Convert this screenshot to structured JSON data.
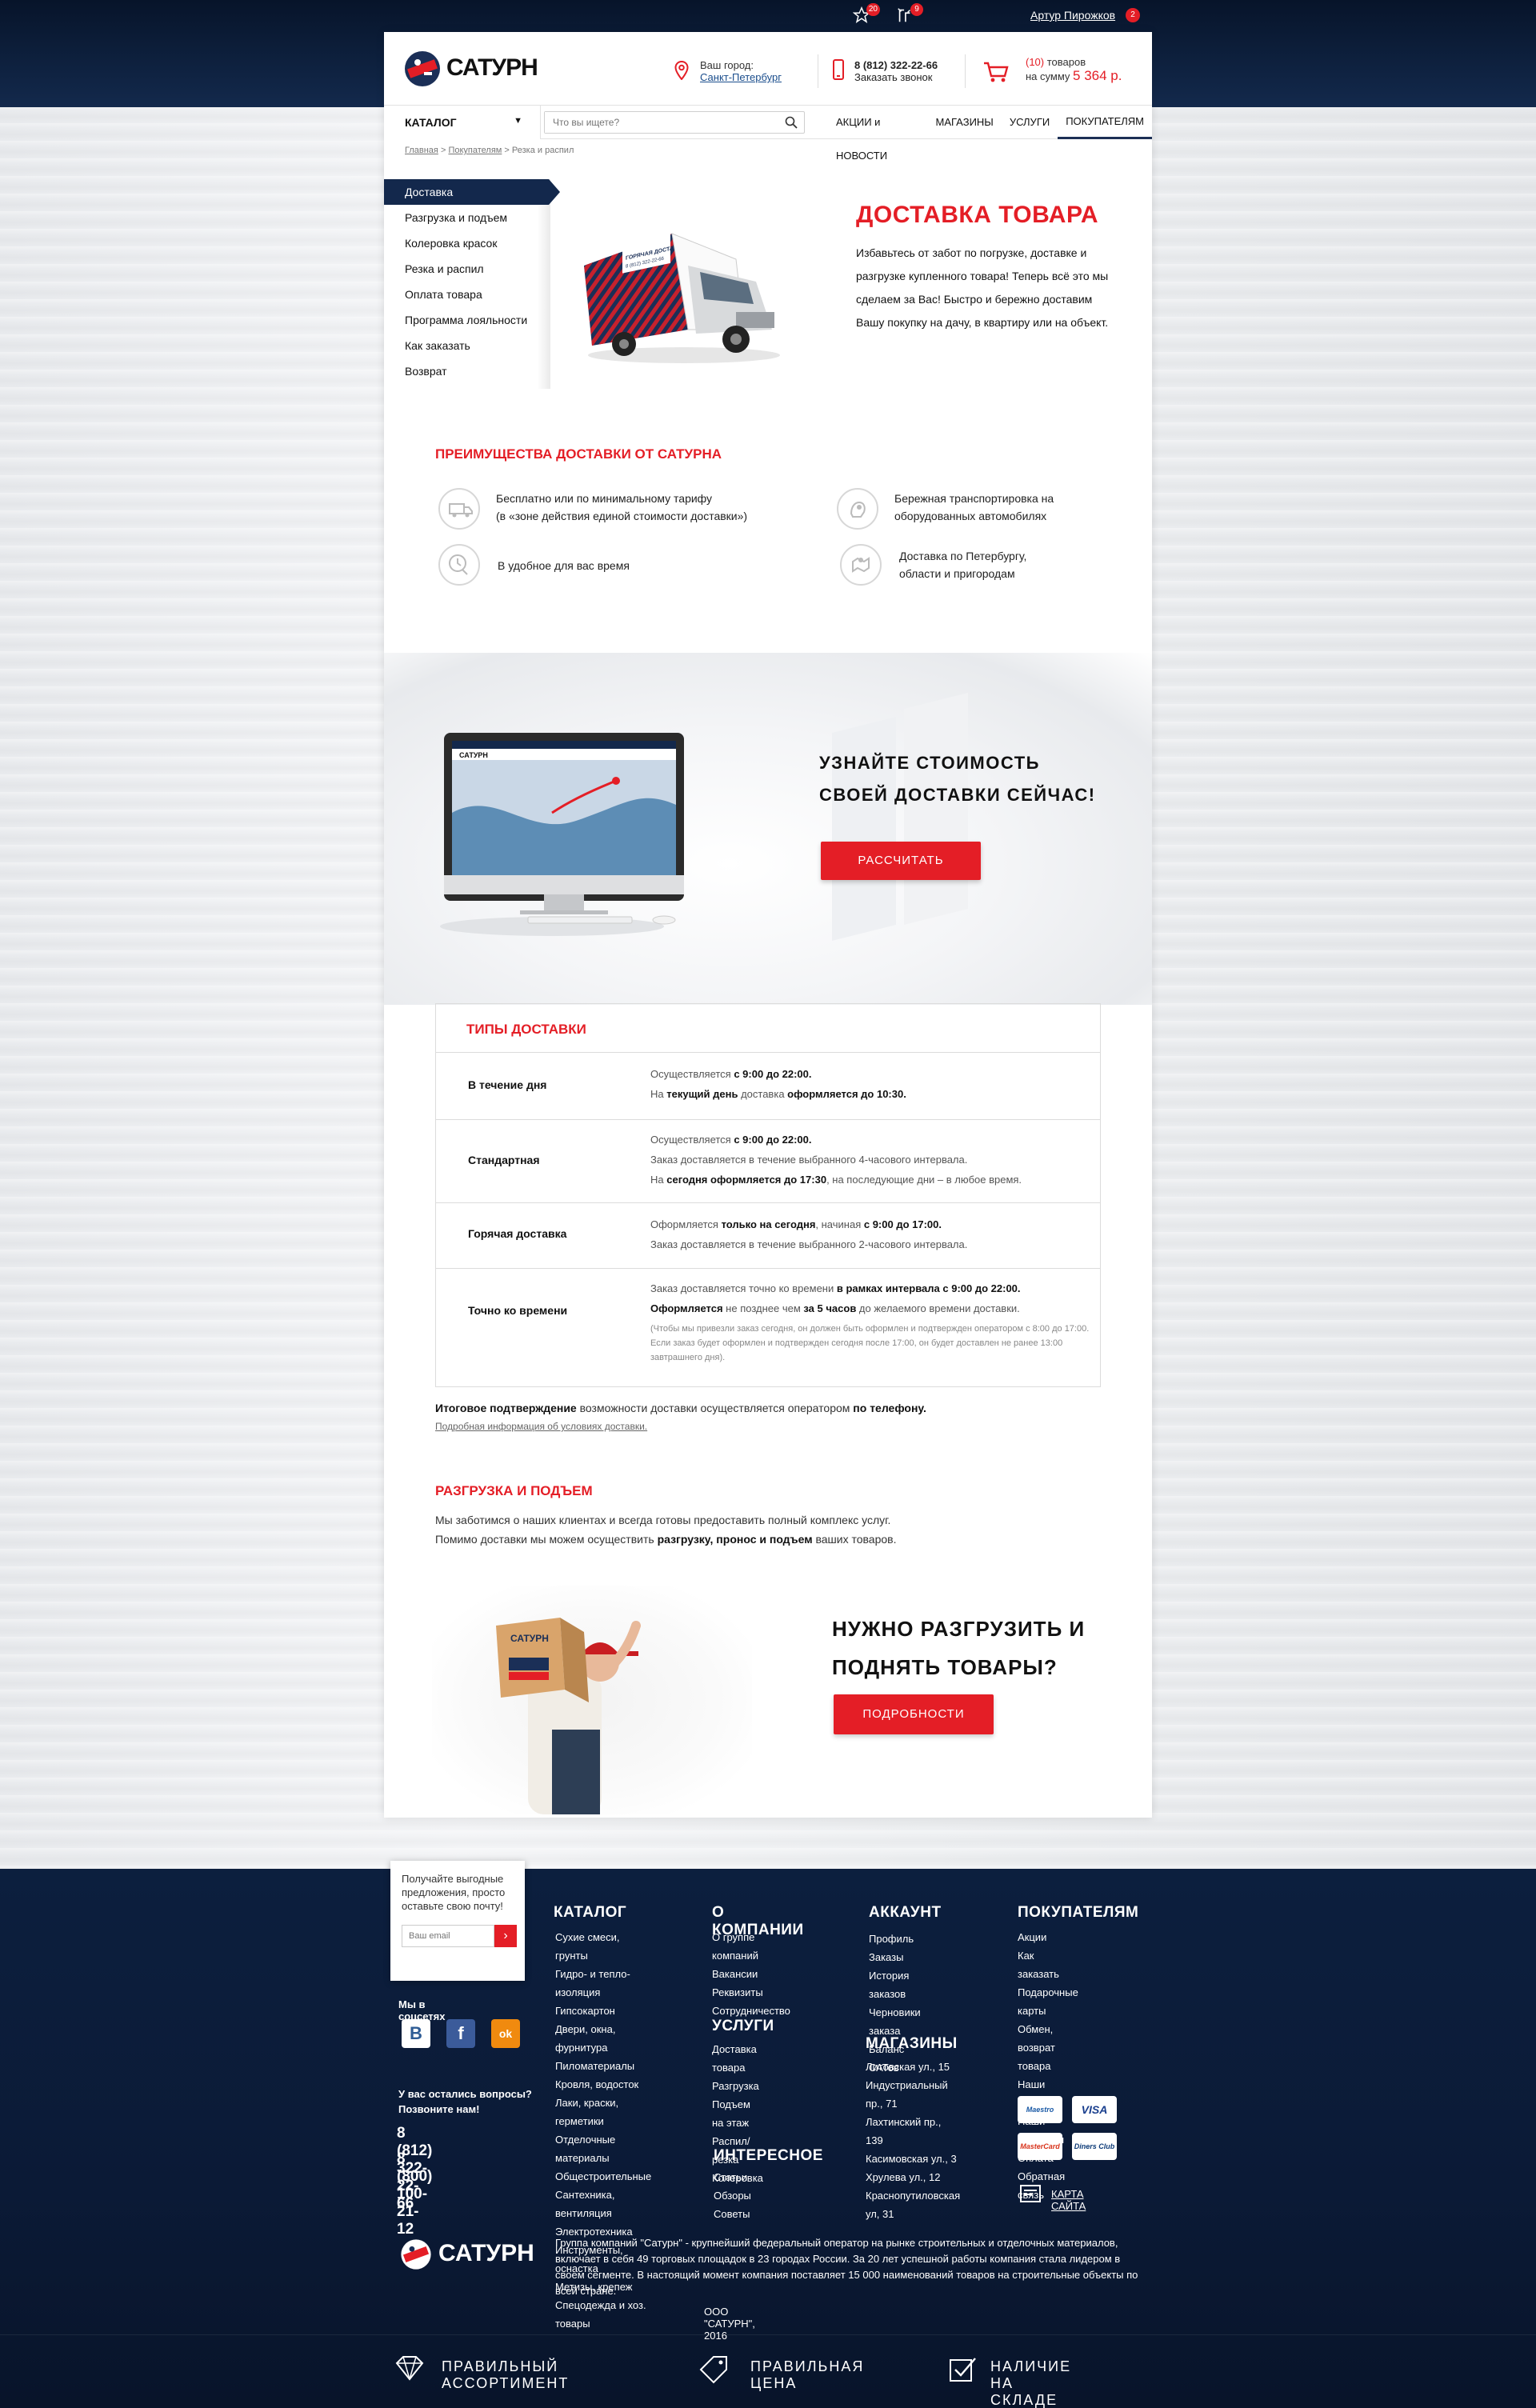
{
  "topbar": {
    "favorites_count": "20",
    "compare_count": "9",
    "user_name": "Артур Пирожков",
    "user_badge": "2"
  },
  "header": {
    "logo_text": "САТУРН",
    "city_label": "Ваш город:",
    "city_value": "Санкт-Петербург",
    "phone": "8 (812) 322-22-66",
    "callback": "Заказать звонок",
    "cart_count": "(10)",
    "cart_items_word": "товаров",
    "cart_sum_label": "на сумму",
    "cart_sum": "5 364 р."
  },
  "nav": {
    "catalog": "КАТАЛОГ",
    "search_placeholder": "Что вы ищете?",
    "links": [
      "АКЦИИ и НОВОСТИ",
      "МАГАЗИНЫ",
      "УСЛУГИ",
      "ПОКУПАТЕЛЯМ"
    ]
  },
  "breadcrumb": {
    "home": "Главная",
    "sep": ">",
    "section": "Покупателям",
    "current": "Резка и распил"
  },
  "sidebar": {
    "items": [
      "Доставка",
      "Разгрузка и подъем",
      "Колеровка красок",
      "Резка и распил",
      "Оплата товара",
      "Программа лояльности",
      "Как заказать",
      "Возврат"
    ]
  },
  "intro": {
    "title": "ДОСТАВКА ТОВАРА",
    "text": "Избавьтесь от забот по погрузке, доставке и разгрузке купленного товара! Теперь всё это мы сделаем за Вас!  Быстро и бережно доставим Вашу покупку на дачу, в квартиру или на объект.",
    "truck_label": "ГОРЯЧАЯ ДОСТАВКА",
    "truck_phone": "8 (812) 322-22-66"
  },
  "advantages": {
    "title": "ПРЕИМУЩЕСТВА ДОСТАВКИ ОТ САТУРНА",
    "items": [
      {
        "line1": "Бесплатно или по минимальному тарифу",
        "line2": "(в «зоне действия единой стоимости доставки»)"
      },
      {
        "line1": "Бережная транспортировка на",
        "line2": "оборудованных автомобилях"
      },
      {
        "line1": "В удобное для вас время",
        "line2": ""
      },
      {
        "line1": "Доставка по Петербургу,",
        "line2": "области и пригородам"
      }
    ]
  },
  "promo": {
    "title_line1": "УЗНАЙТЕ СТОИМОСТЬ",
    "title_line2": "СВОЕЙ ДОСТАВКИ СЕЙЧАС!",
    "button": "РАССЧИТАТЬ",
    "screen_logo": "САТУРН"
  },
  "types": {
    "title": "ТИПЫ ДОСТАВКИ",
    "rows": [
      {
        "name": "В течение дня",
        "l1a": "Осуществляется ",
        "l1b": "с 9:00 до 22:00.",
        "l2a": "На ",
        "l2b": "текущий день",
        "l2c": " доставка ",
        "l2d": "оформляется до 10:30."
      },
      {
        "name": "Стандартная",
        "l1a": "Осуществляется ",
        "l1b": "с 9:00 до 22:00.",
        "l2": "Заказ доставляется в течение выбранного 4-часового интервала.",
        "l3a": "На ",
        "l3b": "сегодня оформляется до 17:30",
        "l3c": ", на последующие дни – в любое время."
      },
      {
        "name": "Горячая доставка",
        "l1a": "Оформляется ",
        "l1b": "только на сегодня",
        "l1c": ", начиная ",
        "l1d": "с 9:00 до 17:00.",
        "l2": "Заказ доставляется в течение выбранного 2-часового интервала."
      },
      {
        "name": "Точно ко времени",
        "l1a": "Заказ доставляется точно ко времени ",
        "l1b": "в рамках интервала с 9:00 до 22:00.",
        "l2a": "Оформляется",
        "l2b": " не позднее чем ",
        "l2c": "за 5 часов",
        "l2d": " до желаемого времени доставки.",
        "note": "(Чтобы мы привезли заказ сегодня, он должен быть оформлен и подтвержден оператором с 8:00 до 17:00. Если заказ будет оформлен и подтвержден сегодня после 17:00, он будет доставлен не ранее 13:00 завтрашнего дня)."
      }
    ]
  },
  "confirm": {
    "a": "Итоговое подтверждение",
    "b": " возможности доставки осуществляется оператором ",
    "c": "по телефону.",
    "link": "Подробная информация об условиях доставки."
  },
  "unload": {
    "title": "РАЗГРУЗКА И ПОДЪЕМ",
    "line1": "Мы заботимся о наших клиентах и всегда готовы предоставить полный комплекс услуг.",
    "line2a": "Помимо доставки мы можем осуществить ",
    "line2b": "разгрузку, пронос и подъем",
    "line2c": " ваших товаров.",
    "promo_line1": "НУЖНО РАЗГРУЗИТЬ И",
    "promo_line2": "ПОДНЯТЬ ТОВАРЫ?",
    "button": "ПОДРОБНОСТИ",
    "box_logo": "САТУРН"
  },
  "footer": {
    "subscribe_text": "Получайте выгодные предложения, просто оставьте свою почту!",
    "subscribe_placeholder": "Ваш email",
    "social_title": "Мы в соцсетях",
    "social": [
      "В",
      "f",
      "ok"
    ],
    "questions": "У вас остались вопросы? Позвоните нам!",
    "phone1": "8 (812) 322-22-66",
    "phone2": "8 (800) 100-21-12",
    "catalog_title": "КАТАЛОГ",
    "catalog_items": [
      "Сухие смеси, грунты",
      "Гидро- и тепло- изоляция",
      "Гипсокартон",
      "Двери, окна, фурнитура",
      "Пиломатериалы",
      "Кровля, водосток",
      "Лаки, краски, герметики",
      "Отделочные материалы",
      "Общестроительные",
      "Сантехника, вентиляция",
      "Электротехника",
      "Инструменты, оснастка",
      "Метизы, крепеж",
      "Спецодежда и хоз. товары"
    ],
    "company_title": "О КОМПАНИИ",
    "company_items": [
      "О группе компаний",
      "Вакансии",
      "Реквизиты",
      "Сотрудничество"
    ],
    "services_title": "УСЛУГИ",
    "services_items": [
      "Доставка товара",
      "Разгрузка",
      "Подъем на этаж",
      "Распил/резка",
      "Колеровка"
    ],
    "interesting_title": "ИНТЕРЕСНОЕ",
    "interesting_items": [
      "Статьи",
      "Обзоры",
      "Советы"
    ],
    "account_title": "АККАУНТ",
    "account_items": [
      "Профиль",
      "Заказы",
      "История заказов",
      "Черновики заказа",
      "Баланс САТов"
    ],
    "shops_title": "МАГАЗИНЫ",
    "shops_items": [
      "Литовская ул., 15",
      "Индустриальный пр., 71",
      "Лахтинский пр., 139",
      "Касимовская ул., 3",
      "Хрулева ул., 12",
      "Краснопутиловская ул, 31"
    ],
    "buyers_title": "ПОКУПАТЕЛЯМ",
    "buyers_items": [
      "Акции",
      "Как заказать",
      "Подарочные карты",
      "Обмен, возврат товара",
      "Наши бренды",
      "Наши партнеры",
      "Оплата",
      "Обратная связь"
    ],
    "payments": [
      "Maestro",
      "VISA",
      "MasterCard",
      "Diners Club"
    ],
    "sitemap": "КАРТА САЙТА",
    "logo_text": "САТУРН",
    "about": "Группа компаний \"Сатурн\" - крупнейший федеральный оператор на рынке строительных и отделочных материалов, включает в себя 49 торговых площадок в 23 городах России. За 20 лет успешной работы компания стала лидером в своем сегменте. В настоящий момент компания поставляет 15 000 наименований товаров на строительные объекты по всей стране.",
    "copyright": "ООО \"САТУРН\", 2016",
    "features": [
      "ПРАВИЛЬНЫЙ АССОРТИМЕНТ",
      "ПРАВИЛЬНАЯ ЦЕНА",
      "НАЛИЧИЕ НА СКЛАДЕ"
    ]
  },
  "colors": {
    "accent_red": "#e41e26",
    "navy": "#13284c"
  }
}
